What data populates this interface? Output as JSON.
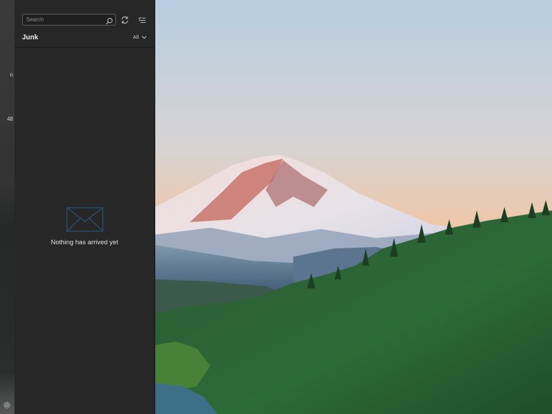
{
  "rail": {
    "fragments": [
      "n",
      "48"
    ],
    "settings_icon": "gear-icon"
  },
  "search": {
    "placeholder": "Search",
    "icon": "search-icon"
  },
  "toolbar": {
    "sync_icon": "sync-icon",
    "select_icon": "select-mode-icon"
  },
  "folder": {
    "title": "Junk",
    "filter_label": "All",
    "filter_icon": "chevron-down-icon"
  },
  "empty_state": {
    "message": "Nothing has arrived yet",
    "icon": "envelope-icon"
  },
  "colors": {
    "pane_bg": "#272727",
    "envelope_accent": "#2f5b86",
    "sky_top": "#b9cfe0",
    "sky_bottom": "#f0b890"
  }
}
